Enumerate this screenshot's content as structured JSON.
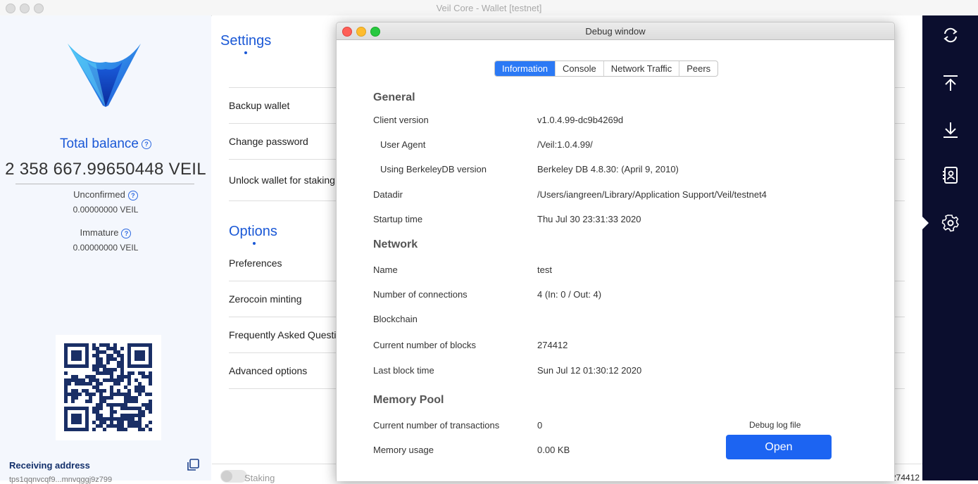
{
  "window": {
    "title": "Veil Core - Wallet [testnet]"
  },
  "balance_panel": {
    "total_label": "Total balance",
    "total_value": "2 358 667.99650448 VEIL",
    "unconfirmed_label": "Unconfirmed",
    "unconfirmed_value": "0.00000000 VEIL",
    "immature_label": "Immature",
    "immature_value": "0.00000000 VEIL",
    "receiving_label": "Receiving address",
    "receiving_address": "tps1qqnvcqf9...mnvqggj9z799"
  },
  "settings": {
    "title": "Settings",
    "items": [
      {
        "label": "Backup wallet"
      },
      {
        "label": "Change password"
      },
      {
        "label": "Unlock wallet for staking"
      }
    ],
    "options_title": "Options",
    "options": [
      {
        "label": "Preferences"
      },
      {
        "label": "Zerocoin minting"
      },
      {
        "label": "Frequently Asked Questions"
      },
      {
        "label": "Advanced options"
      }
    ]
  },
  "statusbar": {
    "staking_label": "Staking",
    "blocks_text": "274412"
  },
  "sidebar_nav": [
    {
      "icon": "sync-icon",
      "name": "sync"
    },
    {
      "icon": "send-upload-icon",
      "name": "send"
    },
    {
      "icon": "receive-download-icon",
      "name": "receive"
    },
    {
      "icon": "address-book-icon",
      "name": "addresses"
    },
    {
      "icon": "gear-icon",
      "name": "settings",
      "active": true
    }
  ],
  "debug_window": {
    "title": "Debug window",
    "tabs": [
      "Information",
      "Console",
      "Network Traffic",
      "Peers"
    ],
    "active_tab": "Information",
    "general": {
      "heading": "General",
      "client_version_label": "Client version",
      "client_version": "v1.0.4.99-dc9b4269d",
      "user_agent_label": "User Agent",
      "user_agent": "/Veil:1.0.4.99/",
      "berkeley_label": "Using BerkeleyDB version",
      "berkeley": "Berkeley DB 4.8.30: (April  9, 2010)",
      "datadir_label": "Datadir",
      "datadir": "/Users/iangreen/Library/Application Support/Veil/testnet4",
      "startup_label": "Startup time",
      "startup": "Thu Jul 30 23:31:33 2020"
    },
    "network": {
      "heading": "Network",
      "name_label": "Name",
      "name": "test",
      "connections_label": "Number of connections",
      "connections": "4 (In: 0 / Out: 4)"
    },
    "blockchain": {
      "heading": "Blockchain",
      "blocks_label": "Current number of blocks",
      "blocks": "274412",
      "last_block_label": "Last block time",
      "last_block": "Sun Jul 12 01:30:12 2020"
    },
    "mempool": {
      "heading": "Memory Pool",
      "tx_label": "Current number of transactions",
      "tx": "0",
      "usage_label": "Memory usage",
      "usage": "0.00 KB"
    },
    "debug_log_label": "Debug log file",
    "open_button": "Open"
  },
  "colors": {
    "accent": "#1a58d6",
    "sidebar_bg": "#0b0e2e",
    "button": "#1c64f2"
  }
}
